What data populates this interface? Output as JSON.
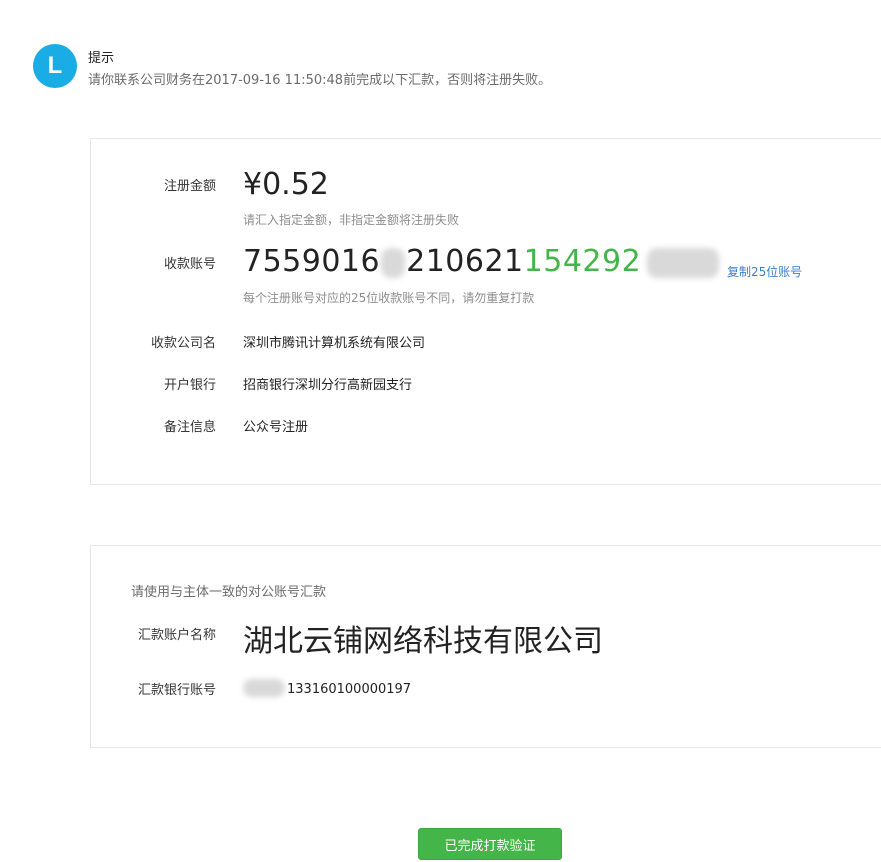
{
  "notice": {
    "avatar_letter": "L",
    "title": "提示",
    "text": "请你联系公司财务在2017-09-16 11:50:48前完成以下汇款，否则将注册失败。"
  },
  "payment": {
    "amount_label": "注册金额",
    "amount": "¥0.52",
    "amount_hint": "请汇入指定金额，非指定金额将注册失败",
    "account_label": "收款账号",
    "account_part1": "7559016",
    "account_part2": "210621",
    "account_part3_green": "154292",
    "copy_link": "复制25位账号",
    "account_hint": "每个注册账号对应的25位收款账号不同，请勿重复打款",
    "company_label": "收款公司名",
    "company_value": "深圳市腾讯计算机系统有限公司",
    "bank_label": "开户银行",
    "bank_value": "招商银行深圳分行高新园支行",
    "note_label": "备注信息",
    "note_value": "公众号注册"
  },
  "remitter": {
    "title": "请使用与主体一致的对公账号汇款",
    "name_label": "汇款账户名称",
    "name_value": "湖北云铺网络科技有限公司",
    "bank_no_label": "汇款银行账号",
    "bank_no_value": "133160100000197"
  },
  "actions": {
    "done_button": "已完成打款验证"
  },
  "colors": {
    "accent_green": "#44b549",
    "link_blue": "#3e7ec8",
    "avatar_blue": "#1aade5"
  }
}
